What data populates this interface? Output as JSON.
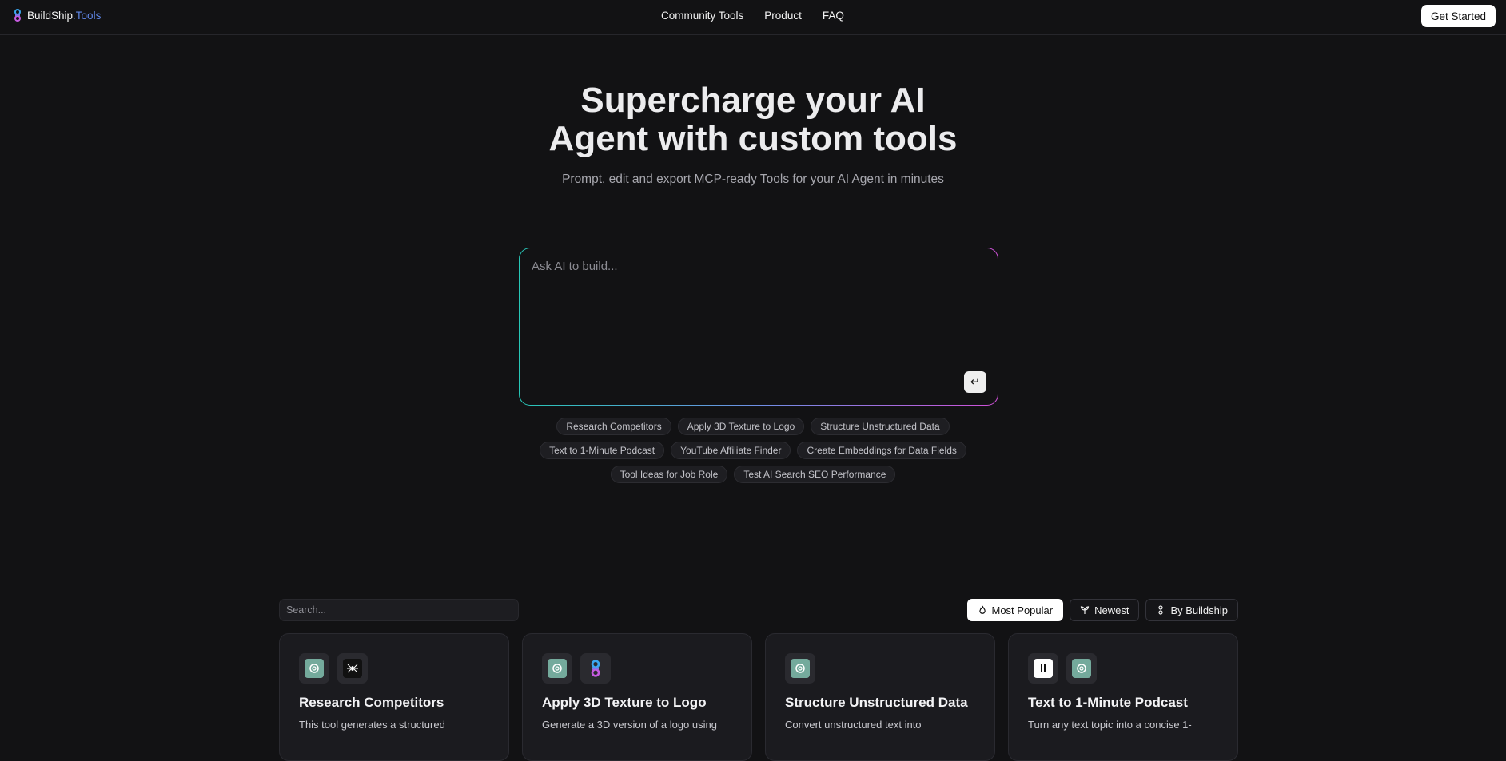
{
  "brand": {
    "name_main": "BuildShip",
    "name_suffix": ".Tools"
  },
  "nav": {
    "items": [
      "Community Tools",
      "Product",
      "FAQ"
    ],
    "cta": "Get Started"
  },
  "hero": {
    "title_line1": "Supercharge your AI",
    "title_line2": "Agent with custom tools",
    "subtitle": "Prompt, edit and export MCP-ready Tools for your AI Agent in minutes"
  },
  "prompt": {
    "placeholder": "Ask AI to build...",
    "submit_icon": "enter-icon"
  },
  "suggestions": {
    "row1": [
      "Research Competitors",
      "Apply 3D Texture to Logo",
      "Structure Unstructured Data"
    ],
    "row2": [
      "Text to 1-Minute Podcast",
      "YouTube Affiliate Finder",
      "Create Embeddings for Data Fields"
    ],
    "row3": [
      "Tool Ideas for Job Role",
      "Test AI Search SEO Performance"
    ]
  },
  "gallery": {
    "search_placeholder": "Search...",
    "filters": [
      "Most Popular",
      "Newest",
      "By Buildship"
    ],
    "active_filter": "Most Popular",
    "cards": [
      {
        "title": "Research Competitors",
        "desc": "This tool generates a structured",
        "icons": [
          "openai-icon",
          "spider-icon"
        ]
      },
      {
        "title": "Apply 3D Texture to Logo",
        "desc": "Generate a 3D version of a logo using",
        "icons": [
          "openai-icon",
          "buildship-icon"
        ]
      },
      {
        "title": "Structure Unstructured Data",
        "desc": "Convert unstructured text into",
        "icons": [
          "openai-icon"
        ]
      },
      {
        "title": "Text to 1-Minute Podcast",
        "desc": "Turn any text topic into a concise 1-",
        "icons": [
          "elevenlabs-icon",
          "openai-icon"
        ]
      }
    ]
  },
  "colors": {
    "background": "#121214",
    "accent_gradient_start": "#27c6b6",
    "accent_gradient_end": "#d050d8",
    "brand_blue": "#5f86e6"
  }
}
